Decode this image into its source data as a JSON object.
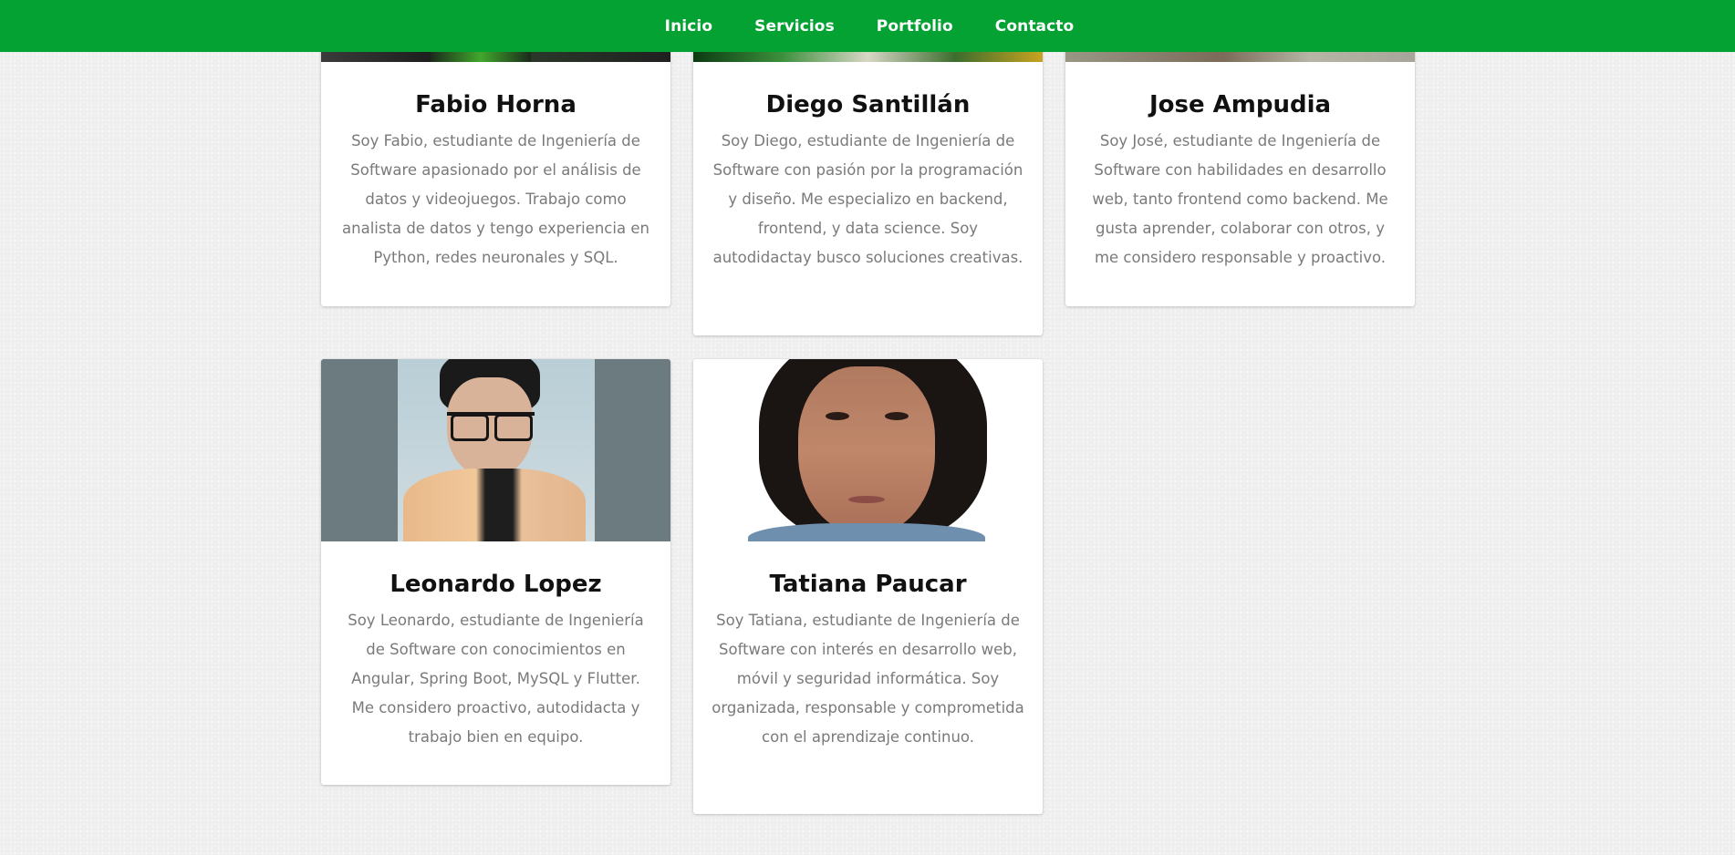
{
  "nav": {
    "items": [
      {
        "label": "Inicio"
      },
      {
        "label": "Servicios"
      },
      {
        "label": "Portfolio"
      },
      {
        "label": "Contacto"
      }
    ]
  },
  "colors": {
    "navbar": "#04a232",
    "background": "#f0f0f0",
    "card": "#ffffff",
    "name_text": "#111111",
    "desc_text": "#7a7a7a"
  },
  "team": [
    {
      "name": "Fabio Horna",
      "description": "Soy Fabio, estudiante de Ingeniería de Software apasionado por el análisis de datos y videojuegos. Trabajo como analista de datos y tengo experiencia en Python, redes neuronales y SQL."
    },
    {
      "name": "Diego Santillán",
      "description": "Soy Diego, estudiante de Ingeniería de Software con pasión por la programación y diseño. Me especializo en backend, frontend, y data science. Soy autodidactay busco soluciones creativas."
    },
    {
      "name": "Jose Ampudia",
      "description": "Soy José, estudiante de Ingeniería de Software con habilidades en desarrollo web, tanto frontend como backend. Me gusta aprender, colaborar con otros, y me considero responsable y proactivo."
    },
    {
      "name": "Leonardo Lopez",
      "description": "Soy Leonardo, estudiante de Ingeniería de Software con conocimientos en Angular, Spring Boot, MySQL y Flutter. Me considero proactivo, autodidacta y trabajo bien en equipo."
    },
    {
      "name": "Tatiana Paucar",
      "description": "Soy Tatiana, estudiante de Ingeniería de Software con interés en desarrollo web, móvil y seguridad informática. Soy organizada, responsable y comprometida con el aprendizaje continuo."
    }
  ]
}
